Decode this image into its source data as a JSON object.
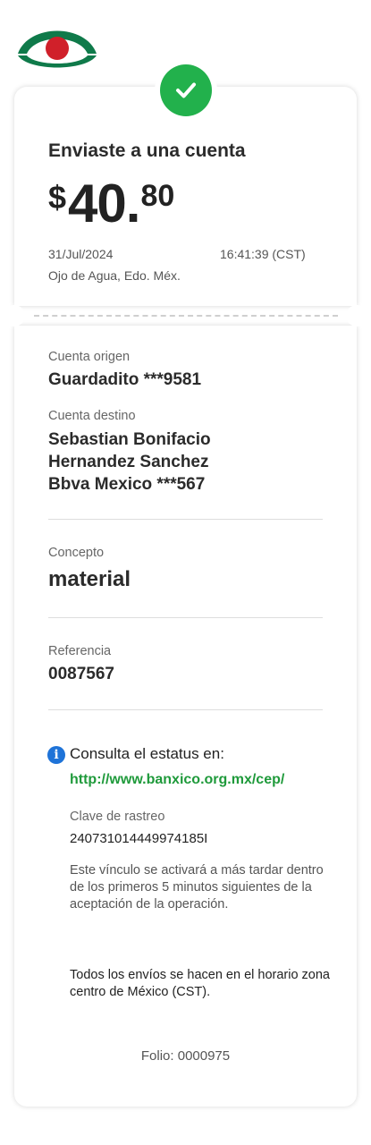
{
  "header": {
    "title": "Enviaste a una cuenta"
  },
  "amount": {
    "currency": "$",
    "integer": "40",
    "decimal_separator": ".",
    "cents": "80"
  },
  "transaction": {
    "date": "31/Jul/2024",
    "time": "16:41:39 (CST)",
    "location": "Ojo de Agua, Edo. Méx."
  },
  "origin": {
    "label": "Cuenta origen",
    "value": "Guardadito ***9581"
  },
  "destination": {
    "label": "Cuenta destino",
    "name_line1": "Sebastian Bonifacio",
    "name_line2": "Hernandez Sanchez",
    "bank": "Bbva Mexico ***567"
  },
  "concept": {
    "label": "Concepto",
    "value": "material"
  },
  "reference": {
    "label": "Referencia",
    "value": "0087567"
  },
  "status": {
    "text": "Consulta el estatus en:",
    "link": "http://www.banxico.org.mx/cep/",
    "tracking_label": "Clave de rastreo",
    "tracking_value": "240731014449974185I",
    "activation_note": "Este vínculo se activará a más tardar dentro de los primeros 5 minutos siguientes de la aceptación de la operación.",
    "timezone_note": "Todos los envíos se hacen en el horario zona centro de México (CST)."
  },
  "footer": {
    "folio": "Folio: 0000975"
  },
  "colors": {
    "success_green": "#22b14c",
    "link_green": "#1f9a3b",
    "info_blue": "#1e73d8",
    "logo_green": "#0f7a4a",
    "logo_red": "#d0202a"
  },
  "icons": {
    "logo": "bank-logo-icon",
    "check": "check-circle-icon",
    "info": "info-icon"
  }
}
